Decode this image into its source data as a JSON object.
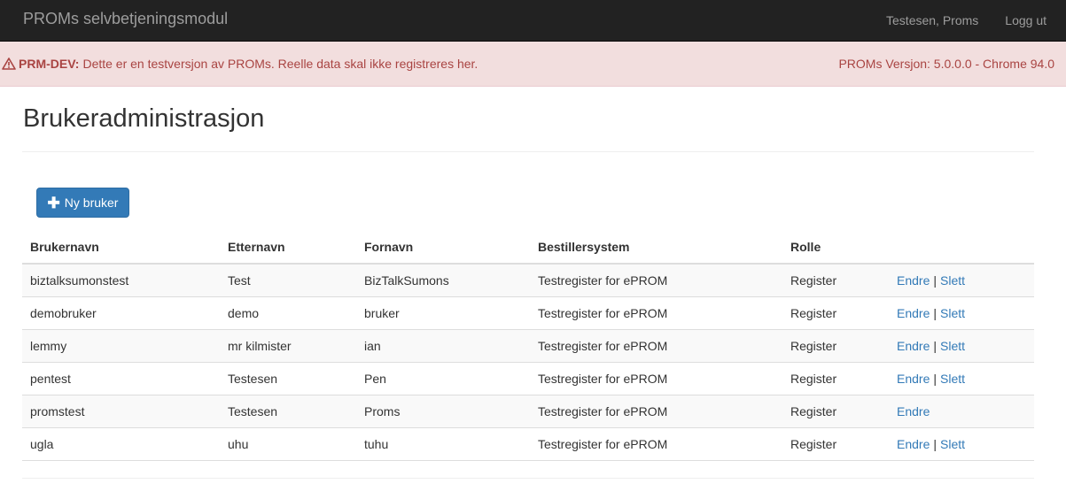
{
  "navbar": {
    "brand": "PROMs selvbetjeningsmodul",
    "user": "Testesen, Proms",
    "logout": "Logg ut"
  },
  "alert": {
    "icon": "warning-triangle-icon",
    "tag": "PRM-DEV:",
    "message": "Dette er en testversjon av PROMs. Reelle data skal ikke registreres her.",
    "version": "PROMs Versjon: 5.0.0.0 - Chrome 94.0"
  },
  "page": {
    "title": "Brukeradministrasjon",
    "new_user_label": "Ny bruker",
    "new_user_icon": "plus-icon"
  },
  "table": {
    "headers": [
      "Brukernavn",
      "Etternavn",
      "Fornavn",
      "Bestillersystem",
      "Rolle",
      ""
    ],
    "edit_label": "Endre",
    "separator": "|",
    "delete_label": "Slett",
    "rows": [
      {
        "username": "biztalksumonstest",
        "lastname": "Test",
        "firstname": "BizTalkSumons",
        "system": "Testregister for ePROM",
        "role": "Register",
        "can_delete": true
      },
      {
        "username": "demobruker",
        "lastname": "demo",
        "firstname": "bruker",
        "system": "Testregister for ePROM",
        "role": "Register",
        "can_delete": true
      },
      {
        "username": "lemmy",
        "lastname": "mr kilmister",
        "firstname": "ian",
        "system": "Testregister for ePROM",
        "role": "Register",
        "can_delete": true
      },
      {
        "username": "pentest",
        "lastname": "Testesen",
        "firstname": "Pen",
        "system": "Testregister for ePROM",
        "role": "Register",
        "can_delete": true
      },
      {
        "username": "promstest",
        "lastname": "Testesen",
        "firstname": "Proms",
        "system": "Testregister for ePROM",
        "role": "Register",
        "can_delete": false
      },
      {
        "username": "ugla",
        "lastname": "uhu",
        "firstname": "tuhu",
        "system": "Testregister for ePROM",
        "role": "Register",
        "can_delete": true
      }
    ]
  },
  "colors": {
    "navbar_bg": "#222222",
    "alert_bg": "#f2dede",
    "alert_text": "#a94442",
    "primary": "#337ab7",
    "link": "#337ab7"
  }
}
